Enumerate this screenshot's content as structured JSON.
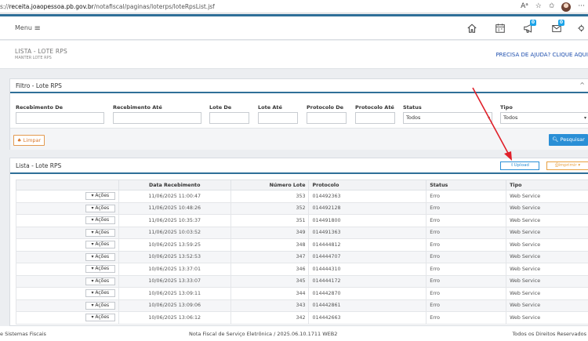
{
  "browser": {
    "url_prefix": "s://",
    "url_host": "receita.joaopessoa.pb.gov.br",
    "url_path": "/notafiscal/paginas/loterps/loteRpsList.jsf",
    "icons": [
      "read-aloud-icon",
      "favorite-icon",
      "favorites-bar-icon",
      "profile-avatar",
      "more-icon"
    ]
  },
  "header": {
    "menu_label": "Menu",
    "menu_glyph": "≡",
    "badges": {
      "megaphone": "0",
      "mail": "0"
    }
  },
  "breadcrumb": {
    "title": "LISTA - LOTE RPS",
    "subtitle": "MANTER LOTE RPS",
    "help": "PRECISA DE AJUDA? CLIQUE AQUI"
  },
  "filter": {
    "title": "Filtro - Lote RPS",
    "collapse_glyph": "^",
    "fields": [
      {
        "label": "Recebimento De",
        "value": ""
      },
      {
        "label": "Recebimento Até",
        "value": ""
      },
      {
        "label": "Lote De",
        "value": ""
      },
      {
        "label": "Lote Até",
        "value": ""
      },
      {
        "label": "Protocolo De",
        "value": ""
      },
      {
        "label": "Protocolo Até",
        "value": ""
      },
      {
        "label": "Status",
        "value": "Todos"
      },
      {
        "label": "Tipo",
        "value": "Todos"
      }
    ],
    "clear_label": "Limpar",
    "search_label": "Pesquisar"
  },
  "list": {
    "title": "Lista - Lote RPS",
    "upload_label": "Upload",
    "print_label": "Imprimir",
    "columns": [
      "",
      "Data Recebimento",
      "Número Lote",
      "Protocolo",
      "Status",
      "Tipo"
    ],
    "action_label": "Ações",
    "rows": [
      {
        "date": "11/06/2025 11:00:47",
        "lote": "353",
        "protocolo": "014492363",
        "status": "Erro",
        "tipo": "Web Service"
      },
      {
        "date": "11/06/2025 10:48:26",
        "lote": "352",
        "protocolo": "014492128",
        "status": "Erro",
        "tipo": "Web Service"
      },
      {
        "date": "11/06/2025 10:35:37",
        "lote": "351",
        "protocolo": "014491800",
        "status": "Erro",
        "tipo": "Web Service"
      },
      {
        "date": "11/06/2025 10:03:52",
        "lote": "349",
        "protocolo": "014491363",
        "status": "Erro",
        "tipo": "Web Service"
      },
      {
        "date": "10/06/2025 13:59:25",
        "lote": "348",
        "protocolo": "014444812",
        "status": "Erro",
        "tipo": "Web Service"
      },
      {
        "date": "10/06/2025 13:52:53",
        "lote": "347",
        "protocolo": "014444707",
        "status": "Erro",
        "tipo": "Web Service"
      },
      {
        "date": "10/06/2025 13:37:01",
        "lote": "346",
        "protocolo": "014444310",
        "status": "Erro",
        "tipo": "Web Service"
      },
      {
        "date": "10/06/2025 13:33:07",
        "lote": "345",
        "protocolo": "014444172",
        "status": "Erro",
        "tipo": "Web Service"
      },
      {
        "date": "10/06/2025 13:09:11",
        "lote": "344",
        "protocolo": "014442870",
        "status": "Erro",
        "tipo": "Web Service"
      },
      {
        "date": "10/06/2025 13:09:06",
        "lote": "343",
        "protocolo": "014442861",
        "status": "Erro",
        "tipo": "Web Service"
      },
      {
        "date": "10/06/2025 13:06:12",
        "lote": "342",
        "protocolo": "014442663",
        "status": "Erro",
        "tipo": "Web Service"
      }
    ]
  },
  "footer": {
    "left": "e Sistemas Fiscais",
    "center": "Nota Fiscal de Serviço Eletrônica / 2025.06.10.1711 WEB2",
    "right": "Todos os Direitos Reservados"
  },
  "colors": {
    "accent": "#2f6f98",
    "primary_button": "#2a8fd6",
    "warning_button": "#e8a040",
    "badge": "#1aa3e8",
    "annotation_arrow": "#e0202a"
  }
}
